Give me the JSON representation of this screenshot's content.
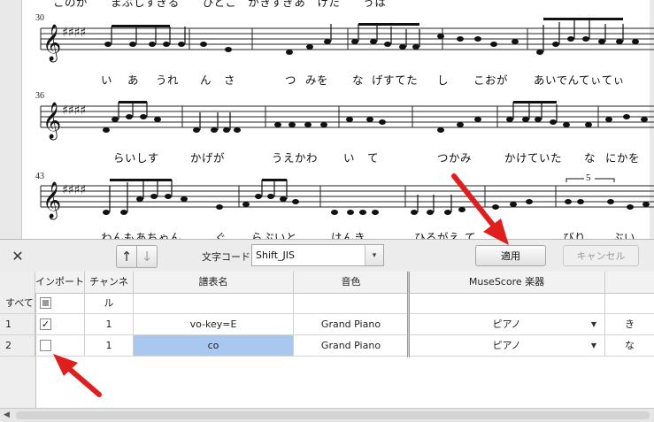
{
  "score": {
    "measure_numbers": [
      "30",
      "36",
      "43"
    ],
    "top_partial_lyrics": "このが　　まぶしすぎる　　ひとこ　がきすぎあ　けた　　うは",
    "lyrics_rows": [
      [
        "い",
        "あ",
        "うれ",
        "ん",
        "さ",
        "つ",
        "みを",
        "な",
        "げすてた",
        "し",
        "こおが",
        "あいでんてぃてぃ"
      ],
      [
        "らいしす",
        "かげが",
        "うえかわ",
        "い",
        "て",
        "つかみ",
        "かけていた",
        "な",
        "にかを"
      ],
      [
        "わんもあちゃん",
        "ぐ",
        "らぶいと",
        "はんき",
        "ひるがえ",
        "て",
        "びり",
        "ぶい"
      ]
    ],
    "tuplet_number": "5"
  },
  "toolbar": {
    "close_icon": "✕",
    "up_icon": "↑",
    "down_icon": "↓",
    "encoding_label": "文字コード:",
    "encoding_value": "Shift_JIS",
    "encoding_arrow": "▾",
    "apply_label": "適用",
    "cancel_label": "キャンセル"
  },
  "table": {
    "headers": {
      "import": "インポート",
      "channel": "チャンネル",
      "staff_name": "譜表名",
      "sound": "音色",
      "instrument": "MuseScore 楽器"
    },
    "all_row_label": "すべて",
    "rows": [
      {
        "num": "1",
        "checked": true,
        "check_mark": "✓",
        "channel": "1",
        "staff_name": "vo-key=E",
        "sound": "Grand Piano",
        "instrument": "ピアノ",
        "extra": "き"
      },
      {
        "num": "2",
        "checked": false,
        "check_mark": "",
        "channel": "1",
        "staff_name": "co",
        "sound": "Grand Piano",
        "instrument": "ピアノ",
        "extra": "な"
      }
    ]
  },
  "colors": {
    "selected_cell": "#a8c8f0",
    "annotation_arrow": "#e01e1e"
  }
}
